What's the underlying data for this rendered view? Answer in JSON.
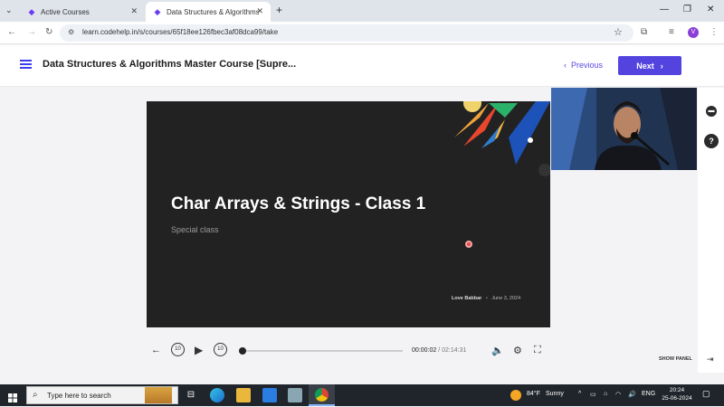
{
  "browser": {
    "tabs": [
      {
        "title": "Active Courses",
        "active": false
      },
      {
        "title": "Data Structures & Algorithms M",
        "active": true
      }
    ],
    "url": "learn.codehelp.in/s/courses/65f18ee126fbec3af08dca99/take",
    "profile_initial": "V",
    "accent": "#6a3df0"
  },
  "header": {
    "course_title": "Data Structures & Algorithms Master Course [Supre...",
    "previous_label": "Previous",
    "next_label": "Next"
  },
  "video": {
    "title": "Char Arrays & Strings - Class 1",
    "subtitle": "Special class",
    "author": "Love Babbar",
    "separator": "•",
    "date": "June 3, 2024"
  },
  "player": {
    "current_time": "00:00:02",
    "time_separator": "/",
    "total_time": "02:14:31",
    "progress": 0.0002,
    "skip_back": "10",
    "skip_forward": "10",
    "show_panel_label": "SHOW PANEL"
  },
  "taskbar": {
    "search_placeholder": "Type here to search",
    "weather_temp": "84°F",
    "weather_desc": "Sunny",
    "language": "ENG",
    "time": "20:24",
    "date": "25-06-2024"
  }
}
